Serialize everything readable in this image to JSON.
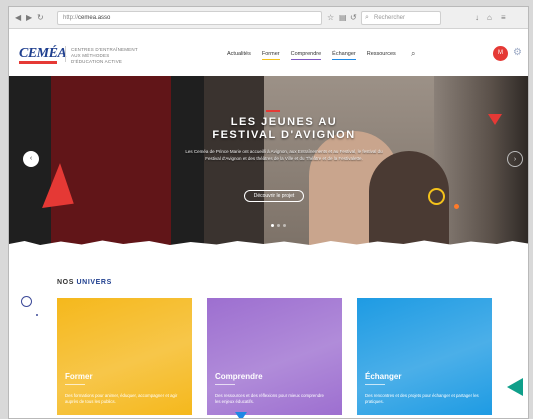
{
  "browser": {
    "back_icon": "back-arrow-icon",
    "url_prefix": "http://",
    "url_main": "cemea.asso",
    "search_placeholder": "Rechercher",
    "toolbar_icons": [
      "download-icon",
      "home-icon",
      "menu-icon"
    ]
  },
  "header": {
    "logo_text": "CEMÉA",
    "tagline": "CENTRES D'ENTRAÎNEMENT AUX MÉTHODES D'ÉDUCATION ACTIVE",
    "nav": [
      {
        "label": "Actualités",
        "underline": ""
      },
      {
        "label": "Former",
        "underline": "#f4c21b"
      },
      {
        "label": "Comprendre",
        "underline": "#7e57c2"
      },
      {
        "label": "Échanger",
        "underline": "#1e88e5"
      },
      {
        "label": "Ressources",
        "underline": ""
      }
    ],
    "user_initial": "M"
  },
  "hero": {
    "title_line1": "LES JEUNES AU",
    "title_line2": "FESTIVAL D'AVIGNON",
    "description": "Les Ceméa de Prince Marie ont accueilli à Avignon, aux Entraînements et au Festival, le festival du Festival d'Avignon et des théâtres de la Ville et du Théâtre et de la Festivalette.",
    "button_label": "Découvrir le projet",
    "prev_label": "‹",
    "next_label": "›"
  },
  "univers": {
    "title_prefix": "NOS ",
    "title_accent": "UNIVERS",
    "cards": [
      {
        "label": "Former",
        "text": "Des formations pour animer, éduquer, accompagner et agir auprès de tous les publics.",
        "color": "#f5b81c"
      },
      {
        "label": "Comprendre",
        "text": "Des ressources et des réflexions pour mieux comprendre les enjeux éducatifs.",
        "color": "#9d6fd0"
      },
      {
        "label": "Échanger",
        "text": "Des rencontres et des projets pour échanger et partager les pratiques.",
        "color": "#1e9be3"
      }
    ]
  }
}
